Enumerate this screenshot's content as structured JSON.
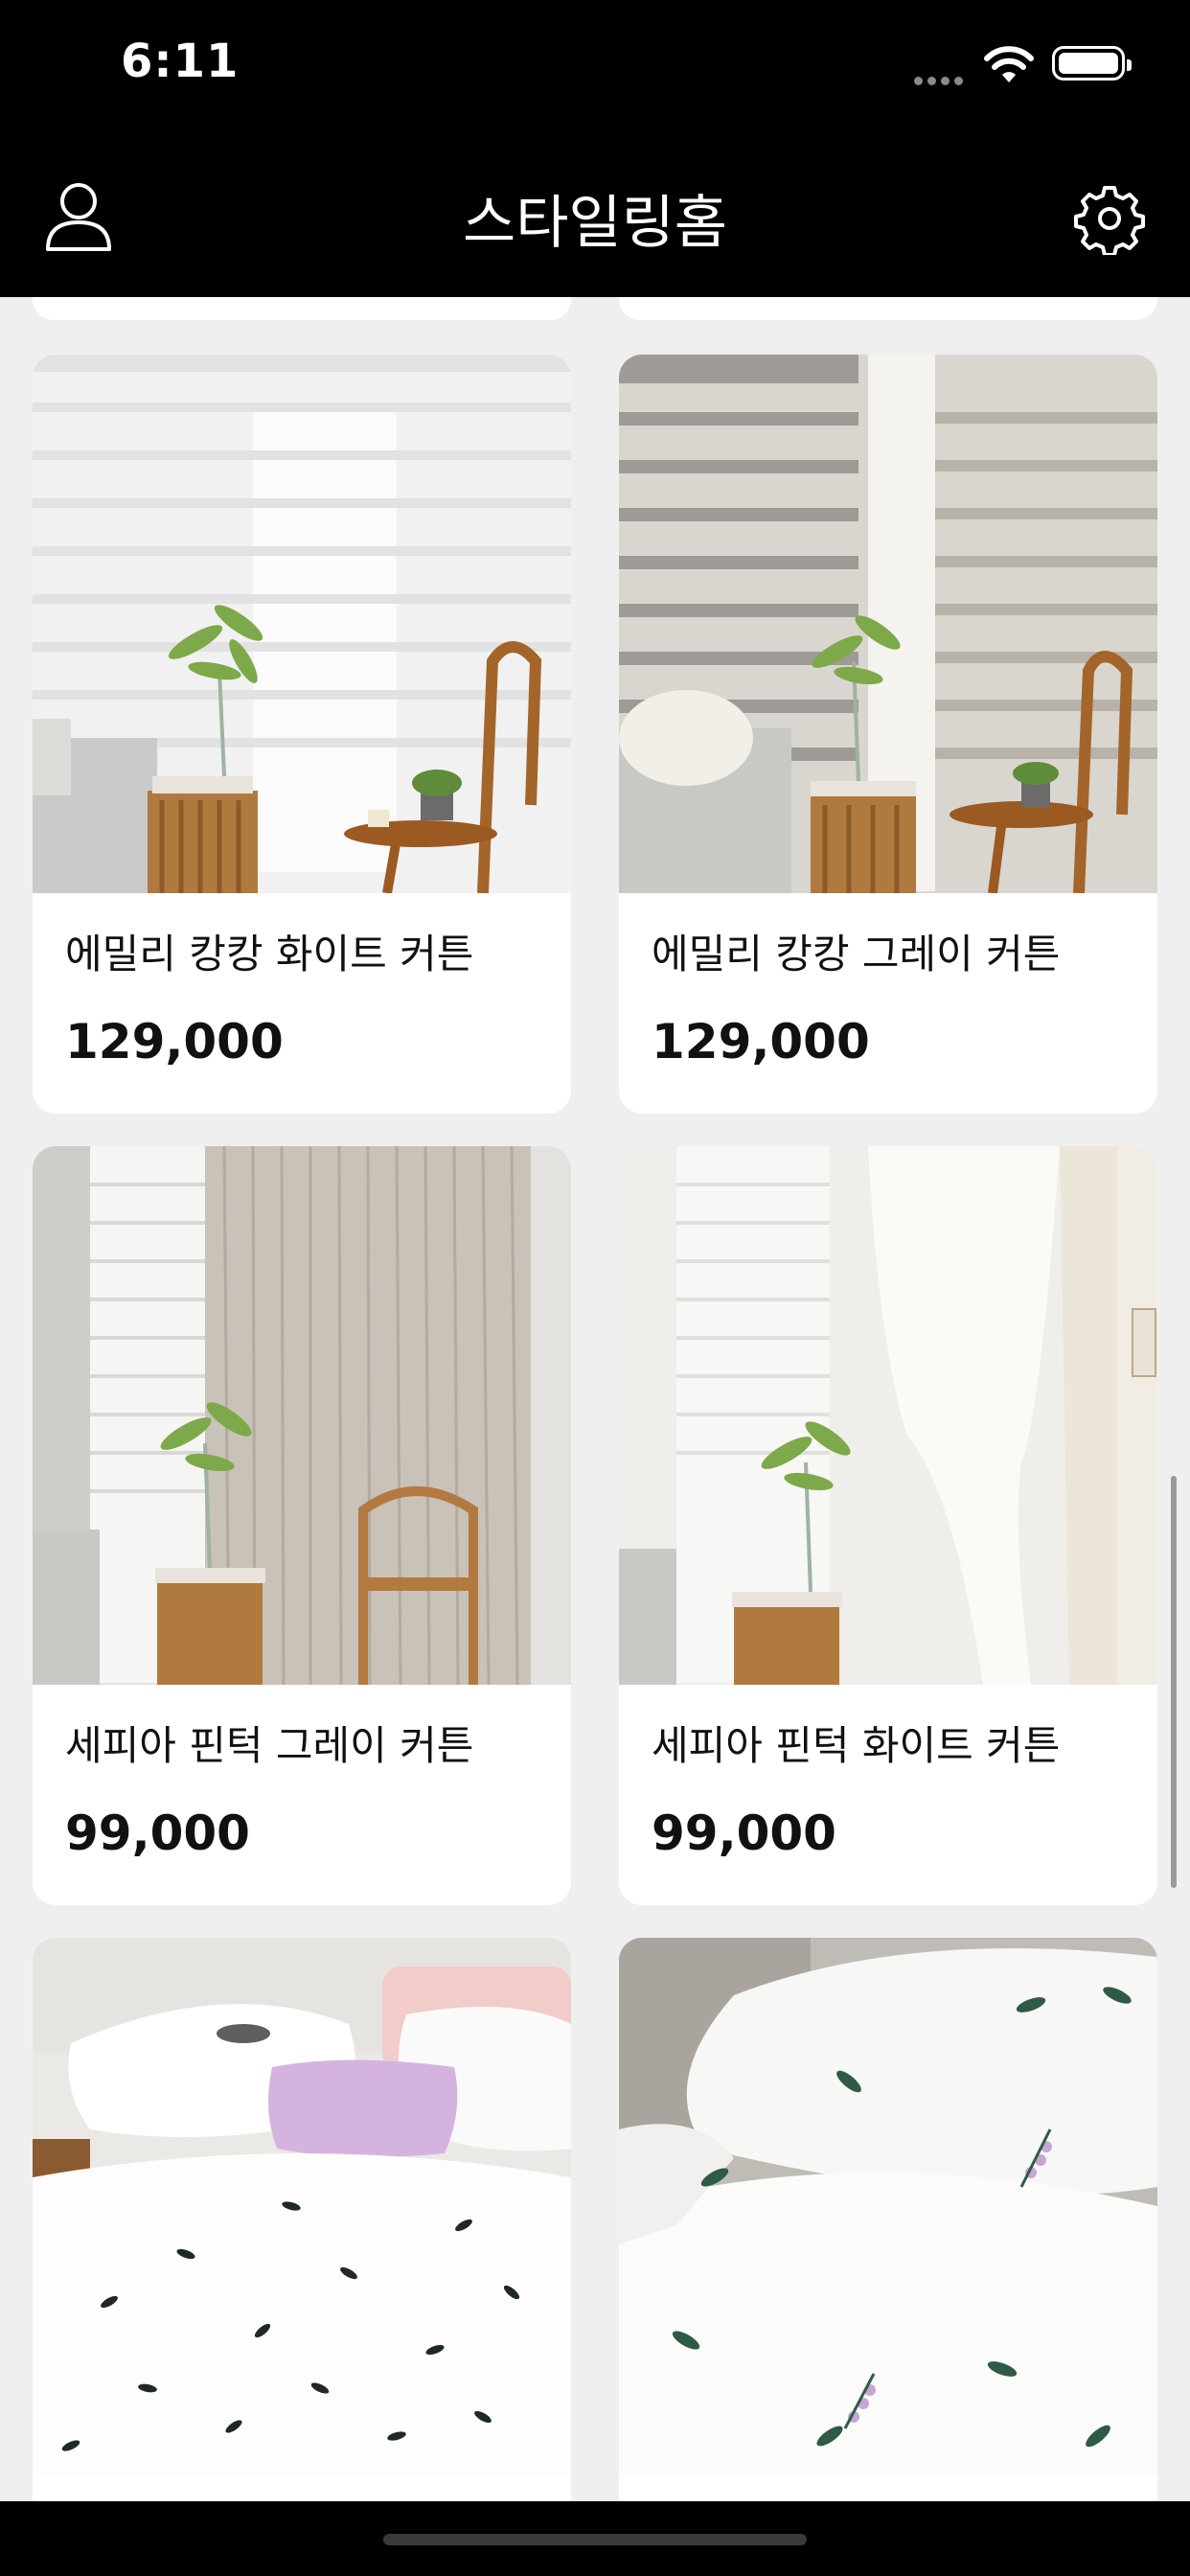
{
  "status_bar": {
    "time": "6:11"
  },
  "nav": {
    "title": "스타일링홈",
    "left_icon": "user-icon",
    "right_icon": "gear-icon"
  },
  "products": [
    {
      "name": "에밀리 캉캉 화이트 커튼",
      "price": "129,000"
    },
    {
      "name": "에밀리 캉캉 그레이 커튼",
      "price": "129,000"
    },
    {
      "name": "세피아 핀턱 그레이 커튼",
      "price": "99,000"
    },
    {
      "name": "세피아 핀턱 화이트 커튼",
      "price": "99,000"
    },
    {
      "name": "",
      "price": ""
    },
    {
      "name": "",
      "price": ""
    }
  ],
  "colors": {
    "bar": "#000000",
    "background": "#efefef",
    "card": "#ffffff",
    "text": "#111111"
  }
}
